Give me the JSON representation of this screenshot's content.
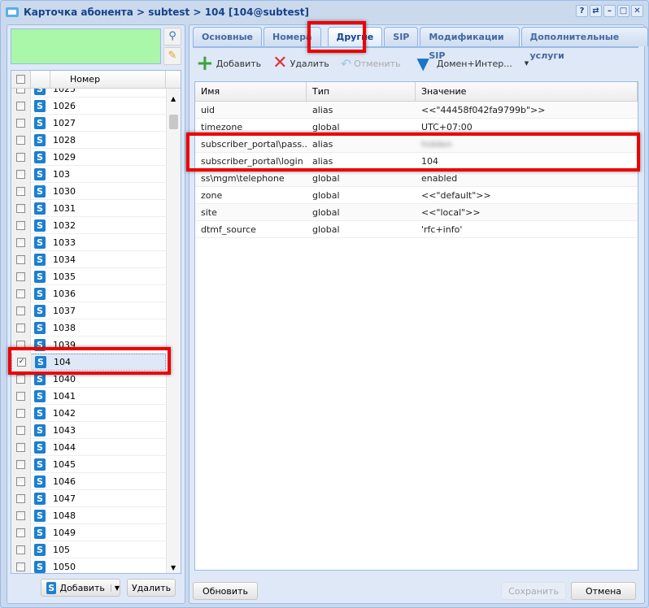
{
  "window": {
    "title": "Карточка абонента > subtest > 104 [104@subtest]",
    "buttons": [
      "?",
      "⇄",
      "–",
      "□",
      "✕"
    ]
  },
  "left": {
    "column_header": "Номер",
    "rows": [
      {
        "number": "1025",
        "checked": false
      },
      {
        "number": "1026",
        "checked": false
      },
      {
        "number": "1027",
        "checked": false
      },
      {
        "number": "1028",
        "checked": false
      },
      {
        "number": "1029",
        "checked": false
      },
      {
        "number": "103",
        "checked": false
      },
      {
        "number": "1030",
        "checked": false
      },
      {
        "number": "1031",
        "checked": false
      },
      {
        "number": "1032",
        "checked": false
      },
      {
        "number": "1033",
        "checked": false
      },
      {
        "number": "1034",
        "checked": false
      },
      {
        "number": "1035",
        "checked": false
      },
      {
        "number": "1036",
        "checked": false
      },
      {
        "number": "1037",
        "checked": false
      },
      {
        "number": "1038",
        "checked": false
      },
      {
        "number": "1039",
        "checked": false
      },
      {
        "number": "104",
        "checked": true
      },
      {
        "number": "1040",
        "checked": false
      },
      {
        "number": "1041",
        "checked": false
      },
      {
        "number": "1042",
        "checked": false
      },
      {
        "number": "1043",
        "checked": false
      },
      {
        "number": "1044",
        "checked": false
      },
      {
        "number": "1045",
        "checked": false
      },
      {
        "number": "1046",
        "checked": false
      },
      {
        "number": "1047",
        "checked": false
      },
      {
        "number": "1048",
        "checked": false
      },
      {
        "number": "1049",
        "checked": false
      },
      {
        "number": "105",
        "checked": false
      },
      {
        "number": "1050",
        "checked": false
      }
    ],
    "add_label": "Добавить",
    "delete_label": "Удалить"
  },
  "tabs": [
    {
      "label": "Основные"
    },
    {
      "label": "Номера"
    },
    {
      "label": "Другие",
      "active": true
    },
    {
      "label": "SIP"
    },
    {
      "label": "Модификации SIP"
    },
    {
      "label": "Дополнительные услуги"
    }
  ],
  "toolbar": {
    "add": "Добавить",
    "delete": "Удалить",
    "undo": "Отменить",
    "filter": "Домен+Интер..."
  },
  "grid": {
    "headers": [
      "Имя",
      "Тип",
      "Значение"
    ],
    "rows": [
      {
        "name": "uid",
        "type": "alias",
        "value": "<<\"44458f042fa9799b\">>"
      },
      {
        "name": "timezone",
        "type": "global",
        "value": "UTC+07:00"
      },
      {
        "name": "subscriber_portal\\pass...",
        "type": "alias",
        "value": "hidden",
        "blurred": true
      },
      {
        "name": "subscriber_portal\\login",
        "type": "alias",
        "value": "104"
      },
      {
        "name": "ss\\mgm\\telephone",
        "type": "global",
        "value": "enabled"
      },
      {
        "name": "zone",
        "type": "global",
        "value": "<<\"default\">>"
      },
      {
        "name": "site",
        "type": "global",
        "value": "<<\"local\">>"
      },
      {
        "name": "dtmf_source",
        "type": "global",
        "value": "'rfc+info'"
      }
    ]
  },
  "footer": {
    "refresh": "Обновить",
    "save": "Сохранить",
    "cancel": "Отмена"
  },
  "colors": {
    "highlight": "#ee0000",
    "search_box": "#aaf7aa",
    "accent": "#15428b"
  }
}
